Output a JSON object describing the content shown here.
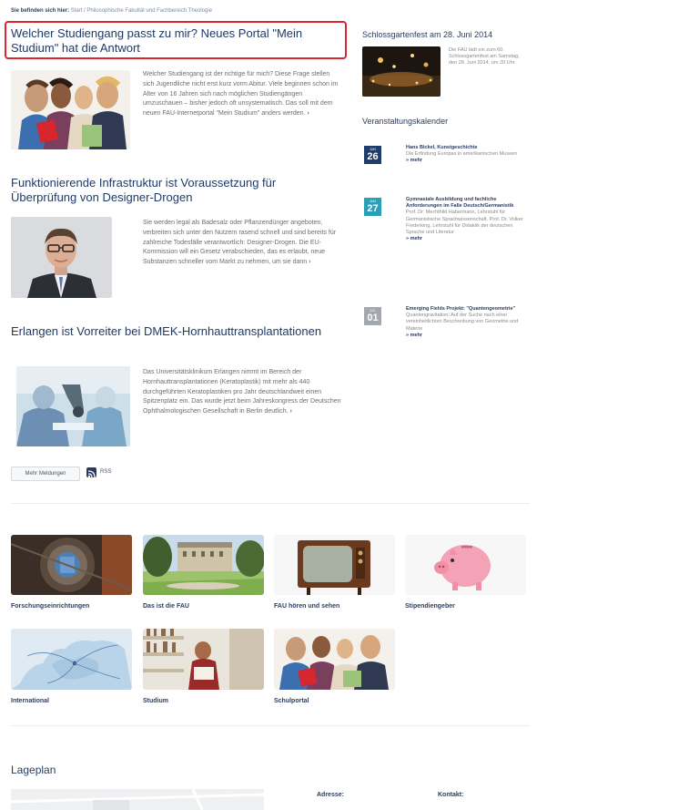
{
  "breadcrumb": {
    "prefix": "Sie befinden sich hier:",
    "home": "Start",
    "separator": "/",
    "current": "Philosophische Fakultät und Fachbereich Theologie"
  },
  "news": [
    {
      "title": "Welcher Studiengang passt zu mir? Neues Portal \"Mein Studium\" hat die Antwort",
      "text": "Welcher Studiengang ist der richtige für mich? Diese Frage stellen sich Jugendliche nicht erst kurz vorm Abitur. Viele beginnen schon im Alter von 16 Jahren sich nach möglichen Studiengängen umzuschauen – bisher jedoch oft unsystematisch. Das soll mit dem neuen FAU-Internetportal \"Mein Studium\" anders werden.",
      "more": "›"
    },
    {
      "title": "Funktionierende Infrastruktur ist Voraussetzung für Überprüfung von Designer-Drogen",
      "text": "Sie werden legal als Badesalz oder Pflanzendünger angeboten, verbreiten sich unter den Nutzern rasend schnell und sind bereits für zahlreiche Todesfälle verantwortlich: Designer-Drogen. Die EU-Kommission will ein Gesetz verabschieden, das es erlaubt, neue Substanzen schneller vom Markt zu nehmen, um sie dann",
      "more": "›"
    },
    {
      "title": "Erlangen ist Vorreiter bei DMEK-Hornhauttransplantationen",
      "text": "Das Universitätsklinikum Erlangen nimmt im Bereich der Hornhauttransplantationen (Keratoplastik) mit mehr als 440 durchgeführten Keratoplastiken pro Jahr deutschlandweit einen Spitzenplatz ein. Das wurde jetzt beim Jahreskongress der Deutschen Ophthalmologischen Gesellschaft in Berlin deutlich.",
      "more": "›"
    }
  ],
  "more_news_label": "Mehr Meldungen",
  "rss_label": "RSS",
  "sidebar": {
    "feature_title": "Schlossgartenfest am 28. Juni 2014",
    "feature_text": "Die FAU lädt ein zum 60. Schlossgartenfest am Samstag, den 28. Juni 2014, um 20 Uhr.",
    "calendar_title": "Veranstaltungskalender",
    "events": [
      {
        "month": "JUN",
        "day": "26",
        "title": "Hans Bickel, Kunstgeschichte",
        "text": "Die Erfindung Europas in amerikanischen Museen",
        "more": "» mehr"
      },
      {
        "month": "JUN",
        "day": "27",
        "title": "Gymnasiale Ausbildung und fachliche Anforderungen im Falle Deutsch/Germanistik",
        "text": "Prof. Dr. Mechthild Habermann, Lehrstuhl für Germanistische Sprachwissenschaft. Prof. Dr. Volker Frederking, Lehrstuhl für Didaktik der deutschen Sprache und Literatur",
        "more": "» mehr"
      },
      {
        "month": "JUL",
        "day": "01",
        "title": "Emerging Fields Projekt: \"Quantengeometrie\"",
        "text": "Quantengravitation: Auf der Suche nach einer vereinheitlichten Beschreibung von Geometrie und Materie",
        "more": "» mehr"
      }
    ]
  },
  "tiles": [
    {
      "label": "Forschungseinrichtungen",
      "icon": "research-building-photo"
    },
    {
      "label": "Das ist die FAU",
      "icon": "castle-garden-photo"
    },
    {
      "label": "FAU hören und sehen",
      "icon": "tv-photo"
    },
    {
      "label": "Stipendiengeber",
      "icon": "piggy-bank-photo"
    },
    {
      "label": "International",
      "icon": "europe-map-photo"
    },
    {
      "label": "Studium",
      "icon": "library-student-photo"
    },
    {
      "label": "Schulportal",
      "icon": "students-photo"
    }
  ],
  "map_section": {
    "title": "Lageplan",
    "address_label": "Adresse:",
    "contact_label": "Kontakt:"
  },
  "colors": {
    "highlight": "#d8272d",
    "title_blue": "#1f3a66",
    "date_navy": "#1e3d6b",
    "date_teal": "#29a0b8",
    "date_gray": "#a3a8ae"
  }
}
